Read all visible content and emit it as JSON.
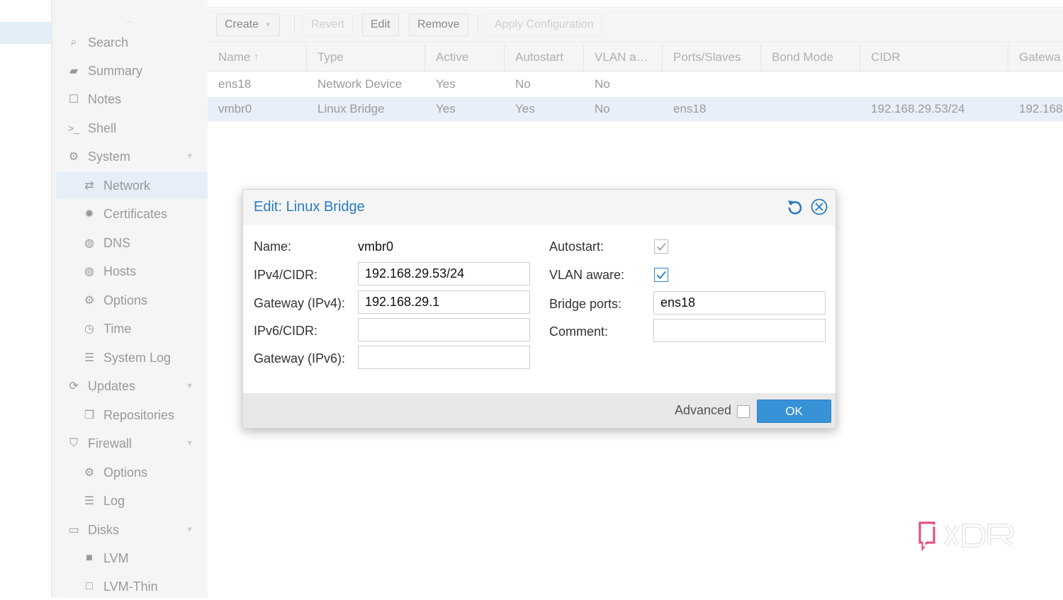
{
  "menu": {
    "items": [
      {
        "label": "Search",
        "icon": "search-icon",
        "glyph": "⌕"
      },
      {
        "label": "Summary",
        "icon": "book-icon",
        "glyph": "▰"
      },
      {
        "label": "Notes",
        "icon": "notes-icon",
        "glyph": "☐"
      },
      {
        "label": "Shell",
        "icon": "terminal-icon",
        "glyph": ">_"
      },
      {
        "label": "System",
        "icon": "cogs-icon",
        "glyph": "⚙"
      },
      {
        "label": "Network",
        "icon": "exchange-icon",
        "glyph": "⇄"
      },
      {
        "label": "Certificates",
        "icon": "certificate-icon",
        "glyph": "✹"
      },
      {
        "label": "DNS",
        "icon": "globe-icon",
        "glyph": "◍"
      },
      {
        "label": "Hosts",
        "icon": "globe-icon",
        "glyph": "◍"
      },
      {
        "label": "Options",
        "icon": "gear-icon",
        "glyph": "⚙"
      },
      {
        "label": "Time",
        "icon": "clock-icon",
        "glyph": "◷"
      },
      {
        "label": "System Log",
        "icon": "list-icon",
        "glyph": "☰"
      },
      {
        "label": "Updates",
        "icon": "refresh-icon",
        "glyph": "⟳"
      },
      {
        "label": "Repositories",
        "icon": "files-icon",
        "glyph": "❐"
      },
      {
        "label": "Firewall",
        "icon": "shield-icon",
        "glyph": "⛉"
      },
      {
        "label": "Options",
        "icon": "gear-icon",
        "glyph": "⚙"
      },
      {
        "label": "Log",
        "icon": "list-icon",
        "glyph": "☰"
      },
      {
        "label": "Disks",
        "icon": "hdd-icon",
        "glyph": "▭"
      },
      {
        "label": "LVM",
        "icon": "square-icon",
        "glyph": "■"
      },
      {
        "label": "LVM-Thin",
        "icon": "square-outline-icon",
        "glyph": "□"
      }
    ]
  },
  "toolbar": {
    "create": "Create",
    "revert": "Revert",
    "edit": "Edit",
    "remove": "Remove",
    "apply": "Apply Configuration"
  },
  "grid": {
    "columns": [
      "Name",
      "Type",
      "Active",
      "Autostart",
      "VLAN a…",
      "Ports/Slaves",
      "Bond Mode",
      "CIDR",
      "Gatewa"
    ],
    "rows": [
      [
        "ens18",
        "Network Device",
        "Yes",
        "No",
        "No",
        "",
        "",
        "",
        ""
      ],
      [
        "vmbr0",
        "Linux Bridge",
        "Yes",
        "Yes",
        "No",
        "ens18",
        "",
        "192.168.29.53/24",
        "192.168"
      ]
    ]
  },
  "dialog": {
    "title": "Edit: Linux Bridge",
    "name_label": "Name:",
    "name_value": "vmbr0",
    "ipv4_label": "IPv4/CIDR:",
    "ipv4_value": "192.168.29.53/24",
    "gw4_label": "Gateway (IPv4):",
    "gw4_value": "192.168.29.1",
    "ipv6_label": "IPv6/CIDR:",
    "ipv6_value": "",
    "gw6_label": "Gateway (IPv6):",
    "gw6_value": "",
    "autostart_label": "Autostart:",
    "autostart_checked": true,
    "vlan_label": "VLAN aware:",
    "vlan_checked": true,
    "ports_label": "Bridge ports:",
    "ports_value": "ens18",
    "comment_label": "Comment:",
    "comment_value": "",
    "advanced_label": "Advanced",
    "ok_label": "OK"
  },
  "colors": {
    "accent": "#3892d8",
    "title": "#2b7bc0",
    "selection": "#e8eff8"
  }
}
